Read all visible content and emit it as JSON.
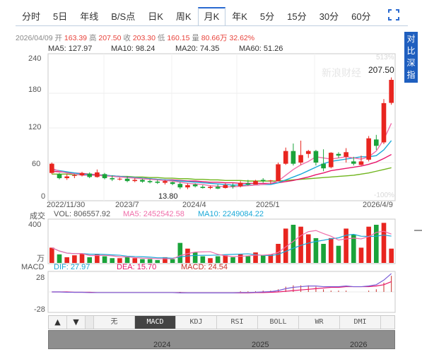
{
  "tabs": [
    {
      "label": "分时",
      "active": false
    },
    {
      "label": "5日",
      "active": false
    },
    {
      "label": "年线",
      "active": false
    },
    {
      "label": "B/S点",
      "active": false
    },
    {
      "label": "日K",
      "active": false
    },
    {
      "label": "周K",
      "active": false
    },
    {
      "label": "月K",
      "active": true
    },
    {
      "label": "年K",
      "active": false
    },
    {
      "label": "5分",
      "active": false
    },
    {
      "label": "15分",
      "active": false
    },
    {
      "label": "30分",
      "active": false
    },
    {
      "label": "60分",
      "active": false
    }
  ],
  "side_button": "对比深指",
  "info": {
    "date": "2026/04/09",
    "open_label": "开",
    "open": "163.39",
    "high_label": "高",
    "high": "207.50",
    "close_label": "收",
    "close": "203.30",
    "low_label": "低",
    "low": "160.15",
    "vol_label": "量",
    "vol": "80.66万",
    "change": "32.62%"
  },
  "ma": [
    {
      "label": "MA5: 127.97",
      "color": "#f06eaa"
    },
    {
      "label": "MA10: 98.24",
      "color": "#1aa9d8"
    },
    {
      "label": "MA20: 74.35",
      "color": "#e8156b"
    },
    {
      "label": "MA60: 51.26",
      "color": "#70b51e"
    }
  ],
  "price_axis": [
    "240",
    "180",
    "120",
    "60",
    "0"
  ],
  "pct_axis": [
    "513%",
    "-100%"
  ],
  "annotations": {
    "high": "207.50",
    "low": "13.80"
  },
  "date_axis": [
    "2022/11/30",
    "2023/7",
    "2024/4",
    "2025/1",
    "2026/4/9"
  ],
  "volume": {
    "title": "成交",
    "vol_label": "VOL: 806557.92",
    "ma5_label": "MA5: 2452542.58",
    "ma10_label": "MA10: 2249084.22",
    "axis_top": "400",
    "axis_bottom": "万"
  },
  "macd": {
    "title": "MACD",
    "dif_label": "DIF: 27.97",
    "dea_label": "DEA: 15.70",
    "macd_label": "MACD: 24.54",
    "axis_top": "28",
    "axis_bottom": "-28"
  },
  "indicator_tabs": [
    {
      "label": "无",
      "active": false
    },
    {
      "label": "MACD",
      "active": true
    },
    {
      "label": "KDJ",
      "active": false
    },
    {
      "label": "RSI",
      "active": false
    },
    {
      "label": "BOLL",
      "active": false
    },
    {
      "label": "WR",
      "active": false
    },
    {
      "label": "DMI",
      "active": false
    }
  ],
  "scroller_years": [
    "2024",
    "2025",
    "2026"
  ],
  "watermark": "新浪财经",
  "colors": {
    "up": "#e8251f",
    "down": "#1aa33a",
    "accent": "#1f5fbf"
  },
  "chart_data": {
    "type": "candlestick",
    "first": "2022/11/30",
    "last": "2026/4/9",
    "interval": "month",
    "candles": [
      {
        "o": 42,
        "h": 60,
        "l": 40,
        "c": 58
      },
      {
        "o": 40,
        "h": 42,
        "l": 31,
        "c": 33
      },
      {
        "o": 33,
        "h": 40,
        "l": 30,
        "c": 36
      },
      {
        "o": 37,
        "h": 40,
        "l": 33,
        "c": 38
      },
      {
        "o": 38,
        "h": 44,
        "l": 36,
        "c": 42
      },
      {
        "o": 41,
        "h": 43,
        "l": 33,
        "c": 35
      },
      {
        "o": 35,
        "h": 48,
        "l": 34,
        "c": 43
      },
      {
        "o": 40,
        "h": 42,
        "l": 31,
        "c": 33
      },
      {
        "o": 33,
        "h": 38,
        "l": 28,
        "c": 31
      },
      {
        "o": 31,
        "h": 34,
        "l": 29,
        "c": 32
      },
      {
        "o": 32,
        "h": 36,
        "l": 26,
        "c": 28
      },
      {
        "o": 28,
        "h": 33,
        "l": 26,
        "c": 30
      },
      {
        "o": 30,
        "h": 32,
        "l": 25,
        "c": 27
      },
      {
        "o": 28,
        "h": 31,
        "l": 24,
        "c": 26
      },
      {
        "o": 27,
        "h": 30,
        "l": 23,
        "c": 25
      },
      {
        "o": 25,
        "h": 30,
        "l": 22,
        "c": 28
      },
      {
        "o": 26,
        "h": 27,
        "l": 21,
        "c": 23
      },
      {
        "o": 23,
        "h": 26,
        "l": 14,
        "c": 17
      },
      {
        "o": 17,
        "h": 24,
        "l": 14,
        "c": 21
      },
      {
        "o": 22,
        "h": 24,
        "l": 17,
        "c": 19
      },
      {
        "o": 18,
        "h": 21,
        "l": 15,
        "c": 16
      },
      {
        "o": 16,
        "h": 20,
        "l": 14,
        "c": 18
      },
      {
        "o": 18,
        "h": 22,
        "l": 14,
        "c": 15
      },
      {
        "o": 16,
        "h": 24,
        "l": 15,
        "c": 21
      },
      {
        "o": 20,
        "h": 24,
        "l": 15,
        "c": 19
      },
      {
        "o": 19,
        "h": 28,
        "l": 17,
        "c": 25
      },
      {
        "o": 24,
        "h": 30,
        "l": 20,
        "c": 22
      },
      {
        "o": 22,
        "h": 30,
        "l": 22,
        "c": 28
      },
      {
        "o": 30,
        "h": 33,
        "l": 25,
        "c": 28
      },
      {
        "o": 28,
        "h": 30,
        "l": 23,
        "c": 29
      },
      {
        "o": 28,
        "h": 60,
        "l": 28,
        "c": 57
      },
      {
        "o": 58,
        "h": 86,
        "l": 56,
        "c": 80
      },
      {
        "o": 80,
        "h": 93,
        "l": 55,
        "c": 58
      },
      {
        "o": 60,
        "h": 98,
        "l": 56,
        "c": 73
      },
      {
        "o": 75,
        "h": 82,
        "l": 68,
        "c": 80
      },
      {
        "o": 80,
        "h": 82,
        "l": 55,
        "c": 60
      },
      {
        "o": 58,
        "h": 83,
        "l": 45,
        "c": 50
      },
      {
        "o": 52,
        "h": 78,
        "l": 50,
        "c": 77
      },
      {
        "o": 75,
        "h": 78,
        "l": 68,
        "c": 72
      },
      {
        "o": 70,
        "h": 85,
        "l": 60,
        "c": 78
      },
      {
        "o": 62,
        "h": 70,
        "l": 55,
        "c": 58
      },
      {
        "o": 56,
        "h": 72,
        "l": 55,
        "c": 62
      },
      {
        "o": 65,
        "h": 106,
        "l": 62,
        "c": 102
      },
      {
        "o": 100,
        "h": 108,
        "l": 82,
        "c": 89
      },
      {
        "o": 95,
        "h": 170,
        "l": 92,
        "c": 163
      },
      {
        "o": 163.39,
        "h": 207.5,
        "l": 160.15,
        "c": 203.3
      }
    ],
    "ma5": [
      50,
      45,
      42,
      40,
      38,
      38,
      38,
      37,
      36,
      35,
      34,
      33,
      32,
      31,
      30,
      29,
      28,
      26,
      24,
      23,
      22,
      20,
      19,
      18,
      18,
      19,
      20,
      21,
      22,
      24,
      28,
      38,
      48,
      56,
      62,
      70,
      68,
      66,
      68,
      70,
      68,
      66,
      70,
      80,
      100,
      128
    ],
    "ma10": [
      48,
      46,
      44,
      42,
      40,
      39,
      38,
      38,
      37,
      36,
      35,
      34,
      33,
      32,
      31,
      30,
      29,
      28,
      27,
      26,
      25,
      24,
      23,
      22,
      21,
      21,
      21,
      21,
      22,
      22,
      25,
      30,
      35,
      40,
      46,
      52,
      58,
      62,
      64,
      66,
      68,
      70,
      70,
      72,
      82,
      98
    ],
    "ma20": [
      45,
      44,
      43,
      42,
      41,
      40,
      39,
      38,
      37,
      36,
      35,
      34,
      33,
      32,
      31,
      30,
      30,
      29,
      28,
      28,
      27,
      26,
      26,
      25,
      25,
      24,
      24,
      24,
      24,
      24,
      25,
      27,
      29,
      32,
      35,
      39,
      42,
      46,
      48,
      50,
      52,
      54,
      57,
      61,
      67,
      74
    ],
    "ma60": [
      40,
      40,
      40,
      39,
      39,
      38,
      38,
      37,
      37,
      36,
      36,
      35,
      35,
      34,
      34,
      33,
      33,
      32,
      32,
      31,
      31,
      30,
      30,
      29,
      29,
      29,
      28,
      28,
      28,
      28,
      28,
      29,
      30,
      31,
      32,
      33,
      34,
      35,
      36,
      37,
      38,
      40,
      42,
      45,
      48,
      51
    ],
    "volume": [
      160,
      90,
      60,
      80,
      100,
      60,
      90,
      70,
      50,
      50,
      60,
      50,
      40,
      40,
      30,
      60,
      40,
      210,
      150,
      110,
      70,
      50,
      70,
      80,
      60,
      90,
      70,
      110,
      80,
      90,
      200,
      360,
      400,
      380,
      300,
      260,
      200,
      260,
      180,
      360,
      300,
      160,
      380,
      400,
      420,
      150
    ],
    "dif": [
      0,
      0,
      -0.5,
      -0.5,
      -0.5,
      -1,
      -1,
      -1,
      -1,
      -1,
      -1,
      -1,
      -1,
      -1,
      -1,
      -1,
      -1,
      -1.5,
      -1.5,
      -1.5,
      -1.5,
      -1.5,
      -1.5,
      -1.5,
      -1.5,
      -1,
      -1,
      -0.5,
      0,
      0.5,
      2,
      5,
      7,
      8,
      9,
      9,
      8,
      8,
      8,
      9,
      8,
      8,
      9,
      11,
      18,
      27.97
    ],
    "dea": [
      0,
      0,
      0,
      -0.5,
      -0.5,
      -0.5,
      -1,
      -1,
      -1,
      -1,
      -1,
      -1,
      -1,
      -1,
      -1,
      -1,
      -1,
      -1,
      -1.5,
      -1.5,
      -1.5,
      -1.5,
      -1.5,
      -1.5,
      -1.5,
      -1.5,
      -1.5,
      -1,
      -1,
      -0.5,
      0,
      1,
      2,
      3,
      4,
      5,
      6,
      7,
      7,
      8,
      8,
      8,
      8,
      9,
      11,
      15.7
    ],
    "ylim": [
      0,
      240
    ],
    "vol_ylim": [
      0,
      400
    ],
    "macd_ylim": [
      -28,
      28
    ]
  }
}
